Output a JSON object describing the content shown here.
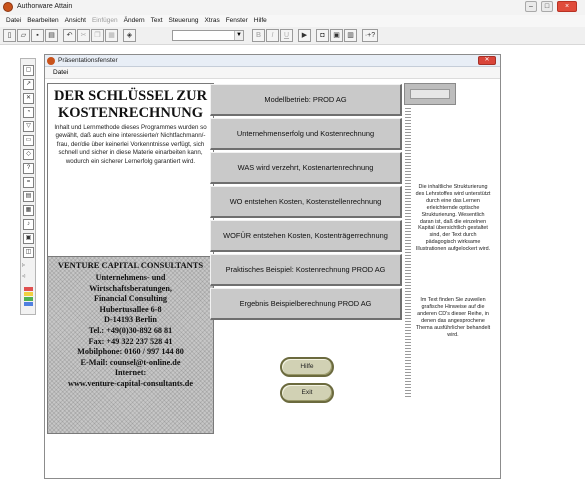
{
  "app": {
    "title": "Authorware Attain",
    "menu": [
      {
        "label": "Datei",
        "enabled": true
      },
      {
        "label": "Bearbeiten",
        "enabled": true
      },
      {
        "label": "Ansicht",
        "enabled": true
      },
      {
        "label": "Einfügen",
        "enabled": false
      },
      {
        "label": "Ändern",
        "enabled": true
      },
      {
        "label": "Text",
        "enabled": true
      },
      {
        "label": "Steuerung",
        "enabled": true
      },
      {
        "label": "Xtras",
        "enabled": true
      },
      {
        "label": "Fenster",
        "enabled": true
      },
      {
        "label": "Hilfe",
        "enabled": true
      }
    ],
    "toolbar_glyphs": {
      "bold": "B",
      "italic": "I",
      "underline": "U",
      "help": "·+?"
    },
    "colors": {
      "brand_icon": "#c8531c",
      "close_red": "#d9453a",
      "panel_grey": "#c7c7c7",
      "pill_button": "#d1d1b4"
    }
  },
  "presentation": {
    "window_title": "Präsentationsfenster",
    "menu_label": "Datei",
    "heading": "DER SCHLÜSSEL ZUR KOSTENRECHNUNG",
    "intro_text": "Inhalt und Lernmethode dieses Programmes wurden so gewählt, daß auch eine interessierte/r Nichtfachmann/-frau, der/die über keinerlei Vorkenntnisse verfügt, sich schnell und sicher in diese Materie einarbeiten kann, wodurch ein sicherer Lernerfolg garantiert wird.",
    "company_name": "VENTURE CAPITAL CONSULTANTS",
    "contact_lines": [
      "Unternehmens- und",
      "Wirtschaftsberatungen,",
      "Financial Consulting",
      "Hubertusallee 6-8",
      "D-14193 Berlin",
      "Tel.: +49(0)30-892 68 81",
      "Fax: +49 322 237 528 41",
      "Mobilphone: 0160 / 997 144 80",
      "E-Mail: counsel@t-online.de",
      "Internet:",
      "www.venture-capital-consultants.de"
    ],
    "menu_buttons": [
      "Modellbetrieb: PROD AG",
      "Unternehmenserfolg und Kostenrechnung",
      "WAS wird verzehrt, Kostenartenrechnung",
      "WO entstehen Kosten, Kostenstellenrechnung",
      "WOFÜR entstehen Kosten, Kostenträgerrechnung",
      "Praktisches Beispiel: Kostenrechnung PROD AG",
      "Ergebnis Beispielberechnung PROD AG"
    ],
    "side_text_1": "Die inhaltliche Strukturierung des Lehrstoffes wird unterstützt durch eine das Lernen erleichternde optische Strukturierung. Wesentlich daran ist, daß die einzelnen Kapital übersichtlich gestaltet sind, der Text durch pädagogisch wirksame Illustrationen aufgelockert wird.",
    "side_text_2": "Im Text finden Sie zuweilen grafische Hinweise auf die anderen CD's dieser Reihe, in denen das angesprochene Thema ausführlicher behandelt wird.",
    "help_button": "Hilfe",
    "exit_button": "Exit"
  }
}
